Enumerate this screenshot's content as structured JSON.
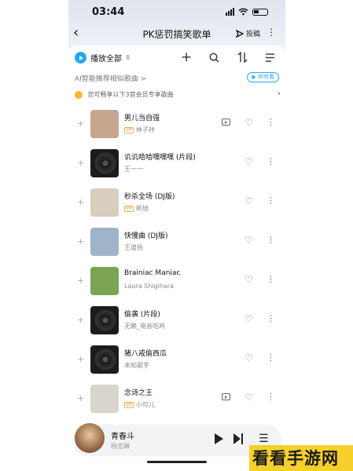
{
  "status_bar": {
    "time": "03:44"
  },
  "nav": {
    "title": "PK惩罚搞笑歌单",
    "cast_label": "投稿"
  },
  "toolbar": {
    "play_all": "播放全部",
    "count": "8"
  },
  "ai_row": {
    "text": "AI智能推荐相似歌曲 >",
    "button": "▶ 听听看"
  },
  "vip_row": {
    "text": "您可畅享以下3首会员专享歌曲"
  },
  "songs": [
    {
      "title": "男儿当自强",
      "artist": "林子祥",
      "has_tag": true,
      "has_mv": true,
      "cover_color": "#c7a58f"
    },
    {
      "title": "讥讥哈哈嘿嘿嘿 (片段)",
      "artist": "王一一",
      "has_tag": false,
      "has_mv": false,
      "cover_color": "#1d1d1d"
    },
    {
      "title": "秒杀全场 (DJ版)",
      "artist": "新旭",
      "has_tag": true,
      "has_mv": false,
      "cover_color": "#d8cdbf"
    },
    {
      "title": "快慢曲 (DJ版)",
      "artist": "王道扬",
      "has_tag": false,
      "has_mv": false,
      "cover_color": "#9fb3c9"
    },
    {
      "title": "Brainiac Maniac",
      "artist": "Laura Shigihara",
      "has_tag": false,
      "has_mv": false,
      "cover_color": "#7aa454"
    },
    {
      "title": "偷袭 (片段)",
      "artist": "无赖_电音吃鸡",
      "has_tag": false,
      "has_mv": false,
      "cover_color": "#1d1d1d"
    },
    {
      "title": "猪八戒偷西瓜",
      "artist": "未知歌手",
      "has_tag": false,
      "has_mv": false,
      "cover_color": "#1d1d1d"
    },
    {
      "title": "念诗之王",
      "artist": "小可儿",
      "has_tag": true,
      "has_mv": true,
      "cover_color": "#d9d4cc"
    }
  ],
  "song_tag": "VIP",
  "player": {
    "title": "青春斗",
    "artist": "杨克琳"
  },
  "watermark": {
    "text": "看看手游网"
  }
}
